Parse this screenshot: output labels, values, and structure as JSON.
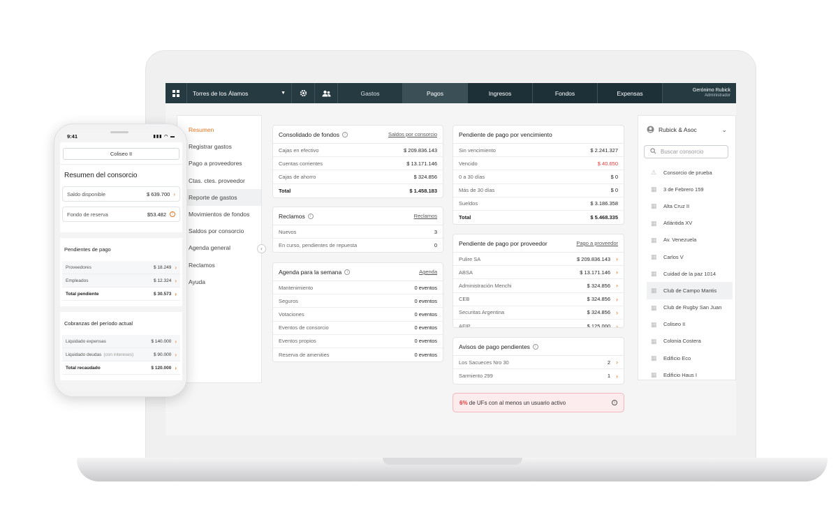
{
  "colors": {
    "accent": "#e9731e",
    "topbar": "#263a42",
    "danger": "#e53935"
  },
  "topbar": {
    "site": "Torres de los Álamos",
    "tabs": [
      "Gastos",
      "Pagos",
      "Ingresos",
      "Fondos",
      "Expensas"
    ],
    "user_name": "Gerónimo Rubick",
    "user_role": "Administrador"
  },
  "sidebar": {
    "items": [
      "Resumen",
      "Registrar gastos",
      "Pago a proveedores",
      "Ctas. ctes. proveedor",
      "Reporte de gastos",
      "Movimientos de fondos",
      "Saldos por consorcio",
      "Agenda general",
      "Reclamos",
      "Ayuda"
    ]
  },
  "consolidado": {
    "title": "Consolidado de fondos",
    "link": "Saldos por consorcio",
    "rows": [
      {
        "label": "Cajas en efectivo",
        "value": "$ 209.836.143"
      },
      {
        "label": "Cuentas corrientes",
        "value": "$ 13.171.146"
      },
      {
        "label": "Cajas de ahorro",
        "value": "$ 324.856"
      },
      {
        "label": "Total",
        "value": "$ 1.458.183"
      }
    ]
  },
  "reclamos": {
    "title": "Reclamos",
    "link": "Reclamos",
    "rows": [
      {
        "label": "Nuevos",
        "value": "3"
      },
      {
        "label": "En curso, pendientes de repuesta",
        "value": "0"
      }
    ]
  },
  "agenda": {
    "title": "Agenda para la semana",
    "link": "Agenda",
    "rows": [
      {
        "label": "Mantenimiento",
        "value": "0 eventos"
      },
      {
        "label": "Seguros",
        "value": "0 eventos"
      },
      {
        "label": "Votaciones",
        "value": "0 eventos"
      },
      {
        "label": "Eventos de consorcio",
        "value": "0 eventos"
      },
      {
        "label": "Eventos propios",
        "value": "0 eventos"
      },
      {
        "label": "Reserva de amenities",
        "value": "0 eventos"
      }
    ]
  },
  "vencimiento": {
    "title": "Pendiente de pago por vencimiento",
    "rows": [
      {
        "label": "Sin vencimiento",
        "value": "$ 2.241.327"
      },
      {
        "label": "Vencido",
        "value": "$ 40.650"
      },
      {
        "label": "0 a 30 días",
        "value": "$ 0"
      },
      {
        "label": "Más de 30 días",
        "value": "$ 0"
      },
      {
        "label": "Sueldos",
        "value": "$ 3.186.358"
      },
      {
        "label": "Total",
        "value": "$ 5.468.335"
      }
    ]
  },
  "proveedor": {
    "title": "Pendiente de pago por proveedor",
    "link": "Pago a proveedor",
    "rows": [
      {
        "label": "Pulire SA",
        "value": "$ 209.836.143"
      },
      {
        "label": "ABSA",
        "value": "$ 13.171.146"
      },
      {
        "label": "Administración Menchi",
        "value": "$ 324.856"
      },
      {
        "label": "CEB",
        "value": "$ 324.856"
      },
      {
        "label": "Securitas Argentina",
        "value": "$ 324.856"
      },
      {
        "label": "AFIP",
        "value": "$ 125.000"
      }
    ]
  },
  "avisos": {
    "title": "Avisos de pago pendientes",
    "rows": [
      {
        "label": "Los Sacueces Nro 30",
        "value": "2"
      },
      {
        "label": "Sarmiento 299",
        "value": "1"
      }
    ]
  },
  "banner": {
    "percent": "6%",
    "text": " de UFs con al menos un usuario activo"
  },
  "rpanel": {
    "org": "Rubick & Asoc",
    "search_placeholder": "Buscar consorcio",
    "items": [
      "Consorcio de prueba",
      "3 de Febrero 159",
      "Alta Cruz II",
      "Atlántida XV",
      "Av. Venezuela",
      "Carlos V",
      "Cuidad de la paz 1014",
      "Club de Campo Mantis",
      "Club de Rugby San Juan",
      "Coliseo II",
      "Colonia Costera",
      "Edificio Eco",
      "Edificio Haus I"
    ]
  },
  "phone": {
    "time": "9:41",
    "consorcio": "Coliseo II",
    "title": "Resumen del consorcio",
    "saldo_label": "Saldo disponible",
    "saldo_value": "$ 639.700",
    "reserva_label": "Fondo de reserva",
    "reserva_value": "$53.482",
    "pend_title": "Pendientes de pago",
    "pend_rows": [
      {
        "label": "Proveedores",
        "value": "$ 18.249"
      },
      {
        "label": "Empleados",
        "value": "$ 12.324"
      },
      {
        "label": "Total pendiente",
        "value": "$ 30.573"
      }
    ],
    "cob_title": "Cobranzas del período actual",
    "cob_rows": [
      {
        "label": "Liquidado expensas",
        "note": "",
        "value": "$ 140.000"
      },
      {
        "label": "Liquidado deudas",
        "note": "(con intereses)",
        "value": "$ 90.000"
      },
      {
        "label": "Total recaudado",
        "note": "",
        "value": "$ 120.000"
      }
    ]
  }
}
